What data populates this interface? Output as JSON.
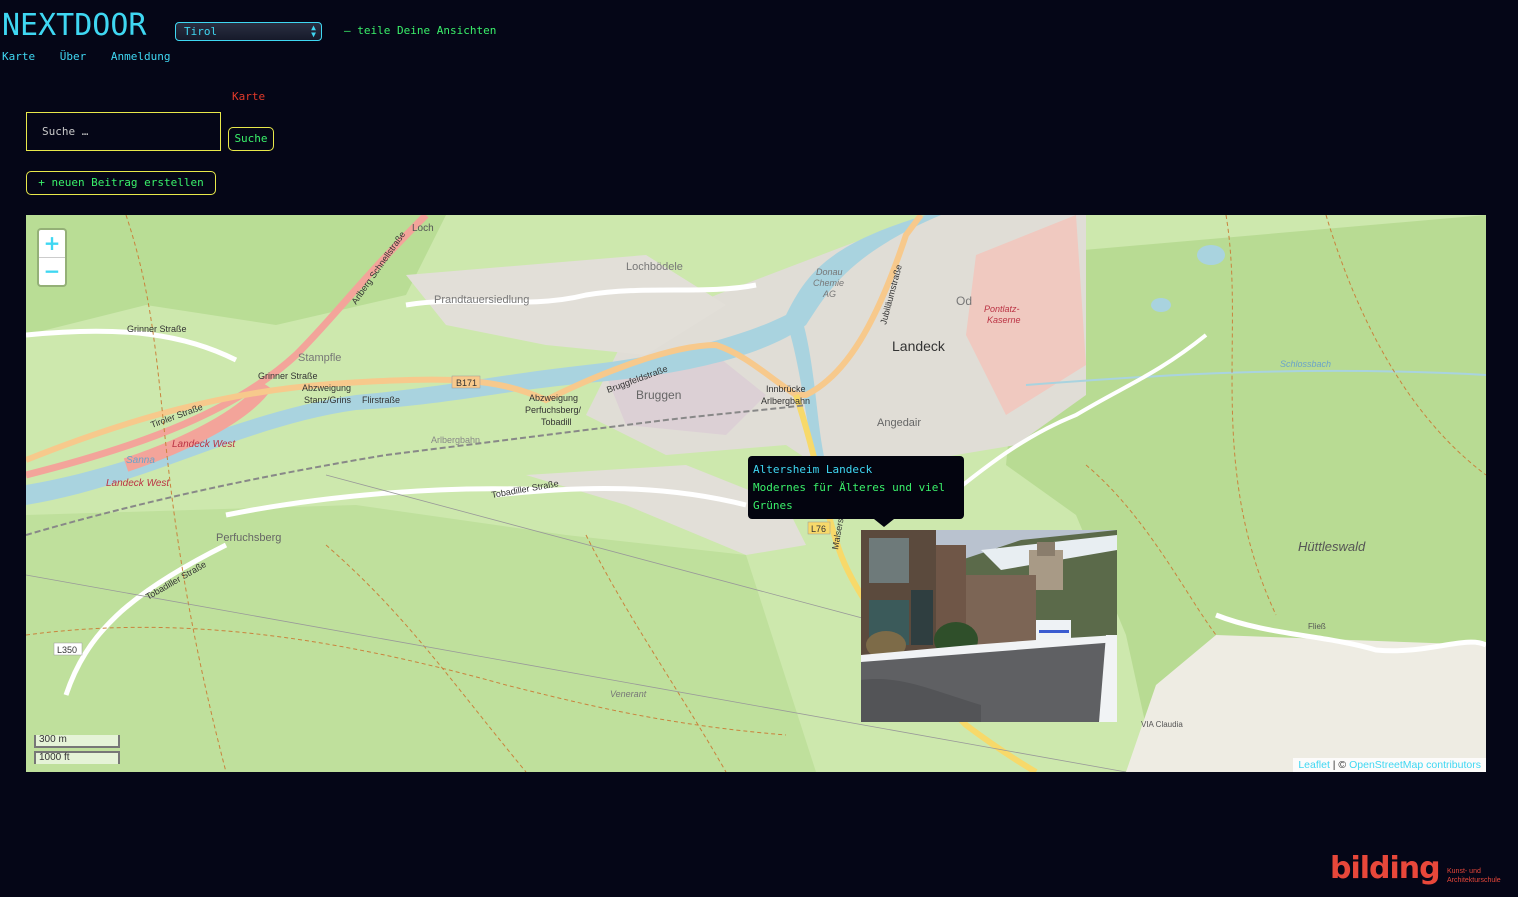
{
  "header": {
    "brand": "NEXTDOOR",
    "region_selected": "Tirol",
    "tagline": "— teile Deine Ansichten"
  },
  "nav": {
    "items": [
      "Karte",
      "Über",
      "Anmeldung"
    ]
  },
  "main": {
    "section_label": "Karte",
    "search_placeholder": "Suche …",
    "search_button": "Suche",
    "new_post_button": "+ neuen Beitrag erstellen"
  },
  "map": {
    "zoom_in": "+",
    "zoom_out": "−",
    "scale_metric": "300 m",
    "scale_imperial": "1000 ft",
    "attribution_leaflet": "Leaflet",
    "attribution_sep": " | © ",
    "attribution_osm": "OpenStreetMap contributors",
    "labels": [
      "Landeck",
      "Bruggen",
      "Angedair",
      "Perfuchsberg",
      "Hüttleswald",
      "Stampfle",
      "Prandtauersiedlung",
      "Lochbödele",
      "Loch",
      "Landeck West",
      "Pontlatz-Kaserne",
      "Donau Chemie AG",
      "Od",
      "Innbrücke Arlbergbahn",
      "Abzweigung Stanz/Grins",
      "Abzweigung Perfuchsberg/ Tobadill",
      "B171",
      "L76",
      "L350",
      "Tiroler Straße",
      "Grinner Straße",
      "Arlberg Schnellstraße",
      "Bruggfeldstraße",
      "Tobadiller Straße",
      "Arlbergbahn",
      "Sanna",
      "Schlossbach",
      "Venerant",
      "VIA Claudia",
      "Flirstraße",
      "Fließ",
      "Malserstraße",
      "Jubiläumstraße"
    ],
    "popup": {
      "title": "Altersheim Landeck",
      "description": "Modernes für Älteres und viel Grünes"
    }
  },
  "footer": {
    "logo_word": "bilding",
    "logo_sub_1": "Kunst- und",
    "logo_sub_2": "Architekturschule"
  },
  "colors": {
    "background": "#050617",
    "accent_cyan": "#3fd7f2",
    "accent_green": "#3af06a",
    "border_yellow": "#e8e84a",
    "label_red": "#e23a2a",
    "logo_red": "#e8473a"
  }
}
